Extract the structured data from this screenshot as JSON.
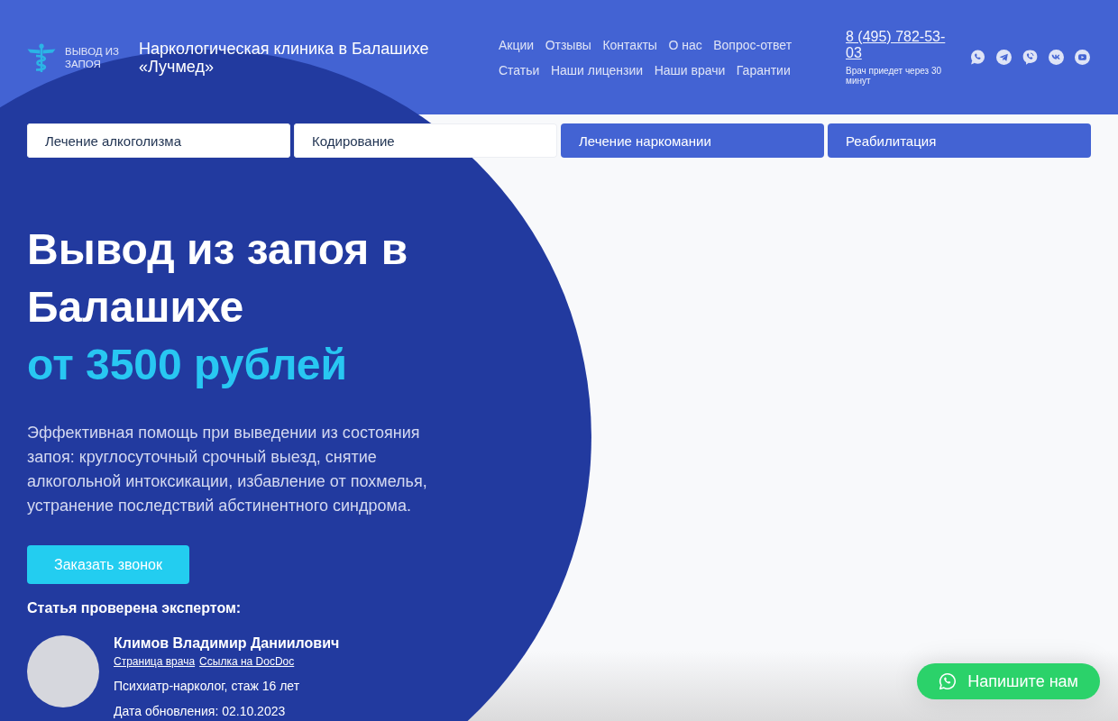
{
  "header": {
    "logo_text": "ВЫВОД ИЗ ЗАПОЯ",
    "title": "Наркологическая клиника в Балашихе «Лучмед»",
    "menu_rows": [
      [
        "Акции",
        "Отзывы",
        "Контакты",
        "О нас",
        "Вопрос-ответ"
      ],
      [
        "Статьи",
        "Наши лицензии",
        "Наши врачи",
        "Гарантии"
      ]
    ],
    "phone": "8 (495) 782-53-03",
    "phone_note": "Врач приедет через 30 минут"
  },
  "service_buttons": [
    {
      "label": "Лечение алкоголизма",
      "kind": "light"
    },
    {
      "label": "Кодирование",
      "kind": "light"
    },
    {
      "label": "Лечение наркомании",
      "kind": "accent"
    },
    {
      "label": "Реабилитация",
      "kind": "accent"
    }
  ],
  "hero": {
    "title": "Вывод из запоя в Балашихе",
    "price": "от 3500 рублей",
    "description": "Эффективная помощь при выведении из состояния запоя: круглосуточный срочный выезд, снятие алкогольной интоксикации, избавление от похмелья, устранение последствий абстинентного синдрома.",
    "cta": "Заказать звонок"
  },
  "expert": {
    "heading": "Статья проверена экспертом:",
    "name": "Климов Владимир Даниилович",
    "links": [
      "Страница врача",
      "Ссылка на DocDoc"
    ],
    "specialty": "Психиатр-нарколог, стаж 16 лет",
    "updated": "Дата обновления: 02.10.2023"
  },
  "chat_button": {
    "label": "Напишите нам"
  }
}
